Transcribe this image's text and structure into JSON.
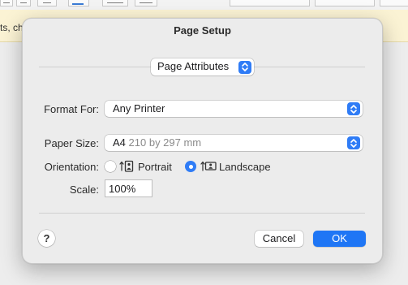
{
  "background": {
    "banner_text": "ts, ch"
  },
  "dialog": {
    "title": "Page Setup",
    "settings_popup": {
      "value": "Page Attributes"
    },
    "format_for": {
      "label": "Format For:",
      "value": "Any Printer"
    },
    "paper_size": {
      "label": "Paper Size:",
      "value": "A4",
      "detail": "210 by 297 mm"
    },
    "orientation": {
      "label": "Orientation:",
      "options": [
        {
          "label": "Portrait",
          "selected": false,
          "icon": "portrait-orientation-icon"
        },
        {
          "label": "Landscape",
          "selected": true,
          "icon": "landscape-orientation-icon"
        }
      ]
    },
    "scale": {
      "label": "Scale:",
      "value": "100%"
    },
    "help_label": "?",
    "cancel_label": "Cancel",
    "ok_label": "OK"
  },
  "colors": {
    "accent": "#2f7cf6",
    "ok_button": "#1f76f5",
    "banner": "#fbf3d4"
  }
}
